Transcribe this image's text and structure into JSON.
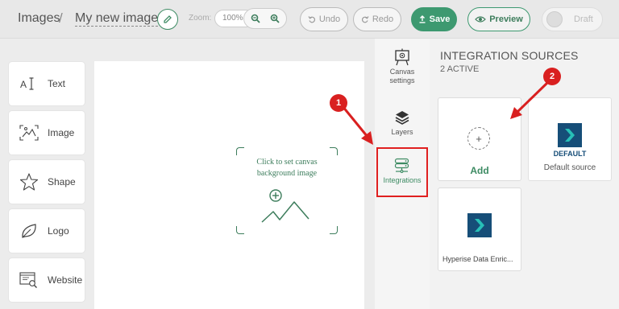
{
  "header": {
    "breadcrumb_root": "Images",
    "separator": "/",
    "title": "My new image",
    "zoom_label": "Zoom:",
    "zoom_value": "100%",
    "undo_label": "Undo",
    "redo_label": "Redo",
    "save_label": "Save",
    "preview_label": "Preview",
    "draft_label": "Draft"
  },
  "tools": [
    {
      "label": "Text",
      "icon": "text-cursor-icon"
    },
    {
      "label": "Image",
      "icon": "image-icon"
    },
    {
      "label": "Shape",
      "icon": "star-icon"
    },
    {
      "label": "Logo",
      "icon": "leaf-icon"
    },
    {
      "label": "Website",
      "icon": "website-icon"
    }
  ],
  "canvas": {
    "placeholder_line1": "Click to set canvas",
    "placeholder_line2": "background image"
  },
  "rail": {
    "canvas_settings": "Canvas settings",
    "layers": "Layers",
    "integrations": "Integrations"
  },
  "panel": {
    "title": "INTEGRATION SOURCES",
    "subtitle": "2 ACTIVE",
    "add_label": "Add",
    "default_badge": "DEFAULT",
    "default_name": "Default source",
    "second_name": "Hyperise Data Enric..."
  },
  "callouts": {
    "one": "1",
    "two": "2"
  },
  "colors": {
    "accent": "#3d9970",
    "brand": "#164e78",
    "callout": "#d92020"
  }
}
